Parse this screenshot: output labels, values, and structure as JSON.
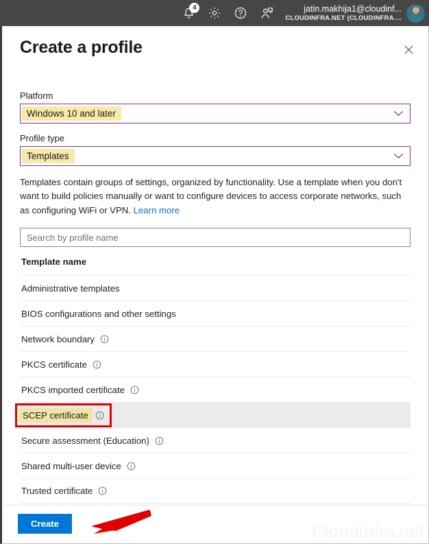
{
  "topbar": {
    "icons": [
      {
        "name": "notifications-bell-icon",
        "badge": "4"
      },
      {
        "name": "settings-gear-icon",
        "badge": ""
      },
      {
        "name": "help-question-icon",
        "badge": ""
      },
      {
        "name": "feedback-person-icon",
        "badge": ""
      }
    ],
    "account": {
      "upn": "jatin.makhija1@cloudinf...",
      "org": "CLOUDINFRA.NET (CLOUDINFRA...."
    }
  },
  "blade": {
    "title": "Create a profile",
    "close_label": "✕"
  },
  "form": {
    "platform": {
      "label": "Platform",
      "value": "Windows 10 and later"
    },
    "profile_type": {
      "label": "Profile type",
      "value": "Templates"
    },
    "description": "Templates contain groups of settings, organized by functionality. Use a template when you don't want to build policies manually or want to configure devices to access corporate networks, such as configuring WiFi or VPN.",
    "learn_more": "Learn more"
  },
  "search": {
    "placeholder": "Search by profile name",
    "value": ""
  },
  "table": {
    "column_header": "Template name",
    "rows": [
      {
        "label": "Administrative templates",
        "info": false,
        "selected": false,
        "highlighted": false
      },
      {
        "label": "BIOS configurations and other settings",
        "info": false,
        "selected": false,
        "highlighted": false
      },
      {
        "label": "Network boundary",
        "info": true,
        "selected": false,
        "highlighted": false
      },
      {
        "label": "PKCS certificate",
        "info": true,
        "selected": false,
        "highlighted": false
      },
      {
        "label": "PKCS imported certificate",
        "info": true,
        "selected": false,
        "highlighted": false
      },
      {
        "label": "SCEP certificate",
        "info": true,
        "selected": true,
        "highlighted": true
      },
      {
        "label": "Secure assessment (Education)",
        "info": true,
        "selected": false,
        "highlighted": false
      },
      {
        "label": "Shared multi-user device",
        "info": true,
        "selected": false,
        "highlighted": false
      },
      {
        "label": "Trusted certificate",
        "info": true,
        "selected": false,
        "highlighted": false
      }
    ]
  },
  "footer": {
    "create_label": "Create",
    "watermark": "Cloudinfra.net"
  },
  "colors": {
    "accent_blue": "#0078d4",
    "annotation_red": "#e00000",
    "highlight_yellow": "#f2e3a6",
    "dropdown_purple": "#8a2f8a",
    "link_blue": "#0f6cbd",
    "topbar_gray": "#464646"
  }
}
